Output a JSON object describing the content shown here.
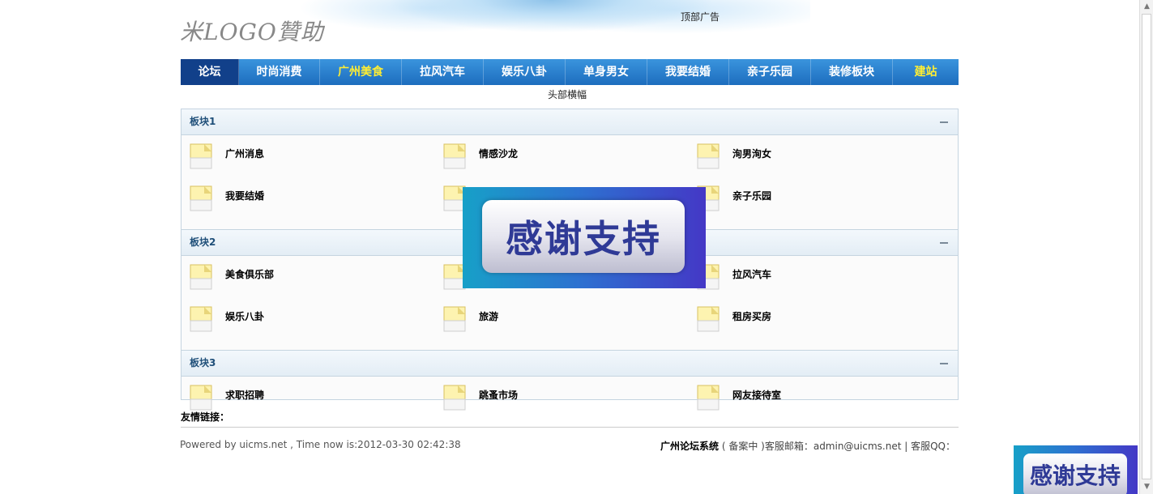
{
  "header": {
    "logo_text": "米LOGO贊助",
    "top_ad": "顶部广告",
    "banner": "头部横幅"
  },
  "nav": {
    "items": [
      {
        "label": "论坛"
      },
      {
        "label": "时尚消费"
      },
      {
        "label": "广州美食"
      },
      {
        "label": "拉风汽车"
      },
      {
        "label": "娱乐八卦"
      },
      {
        "label": "单身男女"
      },
      {
        "label": "我要结婚"
      },
      {
        "label": "亲子乐园"
      },
      {
        "label": "装修板块"
      },
      {
        "label": "建站"
      }
    ]
  },
  "sections": [
    {
      "title": "板块1",
      "forums": [
        "广州消息",
        "情感沙龙",
        "洵男洵女",
        "我要结婚",
        "",
        "亲子乐园"
      ]
    },
    {
      "title": "板块2",
      "forums": [
        "美食俱乐部",
        "",
        "拉风汽车",
        "娱乐八卦",
        "旅游",
        "租房买房"
      ]
    },
    {
      "title": "板块3",
      "forums": [
        "求职招聘",
        "跳蚤市场",
        "网友接待室"
      ]
    }
  ],
  "footer": {
    "friend_links": "友情链接：",
    "powered": "Powered by uicms.net , Time now is:2012-03-30 02:42:38",
    "site_name": "广州论坛系统",
    "right_rest": "( 备案中 )客服邮箱：admin@uicms.net | 客服QQ："
  },
  "popup": {
    "text": "感谢支持"
  },
  "colors": {
    "nav_bg": "#1d6dbe",
    "nav_active": "#11408a",
    "nav_highlight": "#ffee33",
    "section_title": "#1f4f79"
  }
}
